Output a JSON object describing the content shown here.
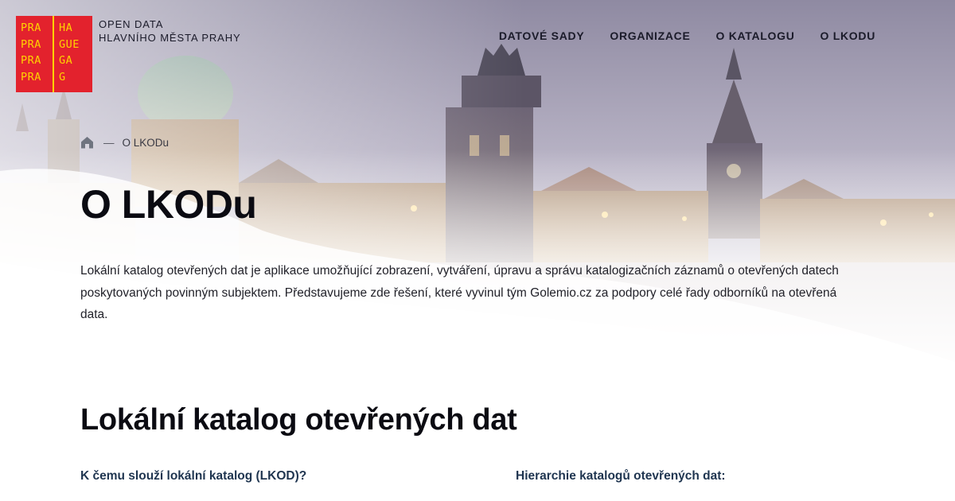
{
  "colors": {
    "logo_red": "#e3222d",
    "logo_yellow": "#ffd200",
    "text_dark": "#0b0b12",
    "subheading_blue": "#1f3550"
  },
  "logo": {
    "left_column": [
      "PRA",
      "PRA",
      "PRA",
      "PRA"
    ],
    "right_column": [
      "HA",
      "GUE",
      "GA",
      "G"
    ]
  },
  "site_name": {
    "line1": "OPEN DATA",
    "line2": "HLAVNÍHO MĚSTA PRAHY"
  },
  "nav": {
    "items": [
      {
        "label": "DATOVÉ SADY"
      },
      {
        "label": "ORGANIZACE"
      },
      {
        "label": "O KATALOGU"
      },
      {
        "label": "O LKODU"
      }
    ]
  },
  "breadcrumb": {
    "home_icon": "home-icon",
    "separator": "—",
    "current": "O LKODu"
  },
  "page": {
    "title": "O LKODu",
    "intro": "Lokální katalog otevřených dat je aplikace umožňující zobrazení, vytváření, úpravu a správu katalogizačních záznamů o otevřených datech poskytovaných povinným subjektem. Představujeme zde řešení, které vyvinul tým Golemio.cz za podpory celé řady odborníků na otevřená data."
  },
  "section": {
    "title": "Lokální katalog otevřených dat",
    "left_heading": "K čemu slouží lokální katalog (LKOD)?",
    "right_heading": "Hierarchie katalogů otevřených dat:"
  }
}
